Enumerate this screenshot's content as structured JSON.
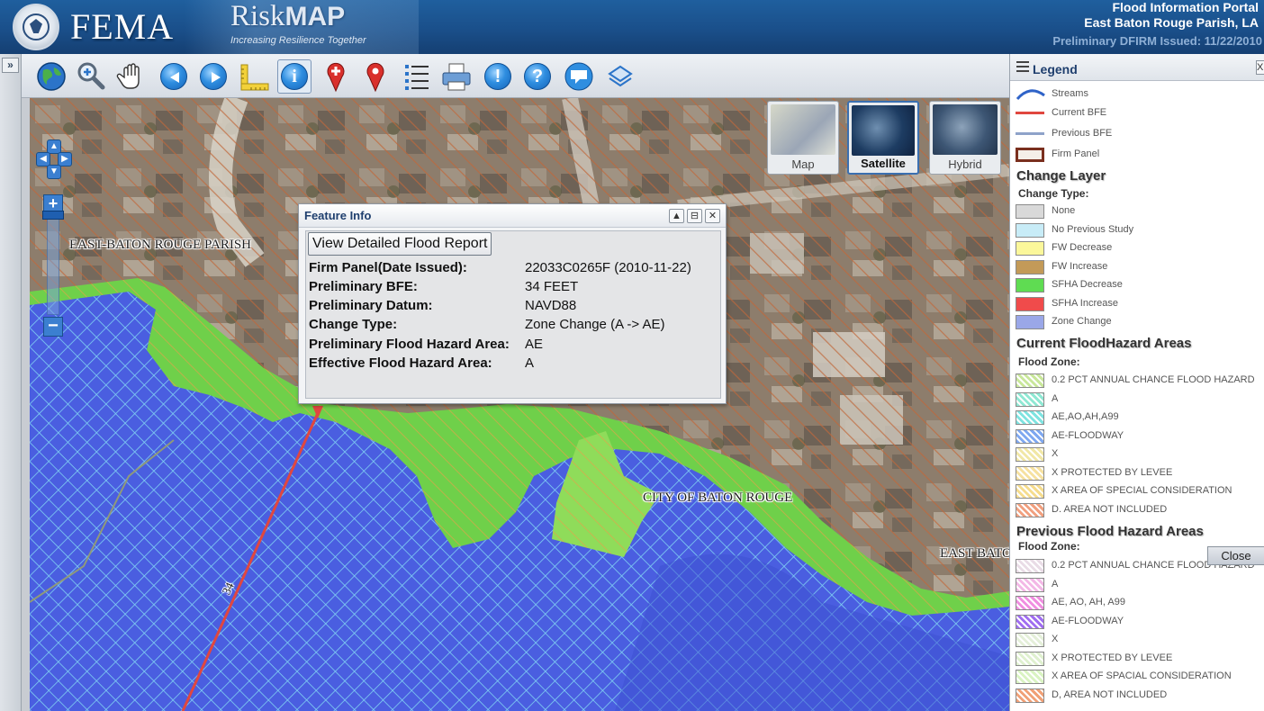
{
  "header": {
    "agency_logo": "FEMA",
    "product_logo_main": "Risk",
    "product_logo_accent": "MAP",
    "tagline": "Increasing Resilience Together",
    "portal_title": "Flood Information Portal",
    "parish": "East Baton Rouge Parish, LA",
    "issued": "Preliminary DFIRM Issued: 11/22/2010"
  },
  "side_toggle": "»",
  "toolbar": {
    "tools": [
      {
        "name": "full-extent-globe-tool",
        "icon": "globe-icon"
      },
      {
        "name": "zoom-tool",
        "icon": "magnifier-icon"
      },
      {
        "name": "pan-tool",
        "icon": "hand-icon"
      },
      {
        "name": "previous-extent-tool",
        "icon": "arrow-left-icon"
      },
      {
        "name": "next-extent-tool",
        "icon": "arrow-right-icon"
      },
      {
        "name": "measure-tool",
        "icon": "ruler-icon"
      },
      {
        "name": "identify-tool",
        "icon": "info-icon",
        "glyph": "i"
      },
      {
        "name": "add-marker-tool",
        "icon": "pushpin-plus-icon"
      },
      {
        "name": "locate-address-tool",
        "icon": "pushpin-icon"
      },
      {
        "name": "legend-tool",
        "icon": "list-icon"
      },
      {
        "name": "print-tool",
        "icon": "printer-icon"
      },
      {
        "name": "alert-tool",
        "icon": "exclamation-icon",
        "glyph": "!"
      },
      {
        "name": "help-tool",
        "icon": "question-icon",
        "glyph": "?"
      },
      {
        "name": "comment-tool",
        "icon": "speech-bubble-icon"
      },
      {
        "name": "layers-tool",
        "icon": "layers-icon"
      }
    ]
  },
  "map": {
    "basemaps": [
      {
        "label": "Map",
        "selected": false
      },
      {
        "label": "Satellite",
        "selected": true
      },
      {
        "label": "Hybrid",
        "selected": false
      }
    ],
    "labels": {
      "parish_label": "EAST-BATON ROUGE PARISH",
      "city_label": "CITY OF BATON ROUGE",
      "east_label": "EAST BATO",
      "bfe_label": "34"
    },
    "nav": {
      "zoom_in": "+",
      "zoom_out": "−"
    }
  },
  "feature_info": {
    "title": "Feature Info",
    "report_button": "View Detailed Flood Report",
    "window_buttons": {
      "collapse": "▲",
      "maximize": "⊟",
      "close": "✕"
    },
    "rows": [
      {
        "key": "Firm Panel(Date Issued):",
        "value": "22033C0265F (2010-11-22)"
      },
      {
        "key": "Preliminary BFE:",
        "value": "34 FEET"
      },
      {
        "key": "Preliminary Datum:",
        "value": "NAVD88"
      },
      {
        "key": "Change Type:",
        "value": "Zone Change (A -> AE)"
      },
      {
        "key": "Preliminary Flood Hazard Area:",
        "value": "AE"
      },
      {
        "key": "Effective Flood Hazard Area:",
        "value": "A"
      }
    ]
  },
  "legend": {
    "title": "Legend",
    "close_x": "X",
    "close_button": "Close",
    "lines": [
      {
        "label": "Streams",
        "color": "#2f63c8"
      },
      {
        "label": "Current BFE",
        "color": "#e0473f"
      },
      {
        "label": "Previous BFE",
        "color": "#8ea2c9"
      },
      {
        "label": "Firm Panel",
        "color": "#7a2f1e"
      }
    ],
    "change_layer_heading": "Change Layer",
    "change_type_heading": "Change Type:",
    "change_types": [
      {
        "label": "None",
        "color": "#d9d9d9"
      },
      {
        "label": "No Previous Study",
        "color": "#c8ecf7"
      },
      {
        "label": "FW Decrease",
        "color": "#fbf79a"
      },
      {
        "label": "FW Increase",
        "color": "#c39a58"
      },
      {
        "label": "SFHA Decrease",
        "color": "#5fdc52"
      },
      {
        "label": "SFHA Increase",
        "color": "#f04b4b"
      },
      {
        "label": "Zone Change",
        "color": "#9aa7e8"
      }
    ],
    "current_heading": "Current FloodHazard Areas",
    "current_sub": "Flood Zone:",
    "current_zones": [
      {
        "label": "0.2 PCT ANNUAL CHANCE FLOOD HAZARD",
        "color": "#c9e79b"
      },
      {
        "label": "A",
        "color": "#8fe8d3"
      },
      {
        "label": "AE,AO,AH,A99",
        "color": "#7ee3e0"
      },
      {
        "label": "AE-FLOODWAY",
        "color": "#7fa8f0"
      },
      {
        "label": "X",
        "color": "#f1e7a6"
      },
      {
        "label": "X PROTECTED BY LEVEE",
        "color": "#f6e1a0"
      },
      {
        "label": "X AREA OF SPECIAL CONSIDERATION",
        "color": "#f5dc8e"
      },
      {
        "label": "D. AREA NOT INCLUDED",
        "color": "#f1a07f"
      }
    ],
    "previous_heading": "Previous Flood Hazard Areas",
    "previous_sub": "Flood Zone:",
    "previous_zones": [
      {
        "label": "0.2 PCT ANNUAL CHANCE FLOOD HAZARD",
        "color": "#e9dce6"
      },
      {
        "label": "A",
        "color": "#f3b8e6"
      },
      {
        "label": "AE, AO, AH, A99",
        "color": "#f08ee0"
      },
      {
        "label": "AE-FLOODWAY",
        "color": "#a06ef0"
      },
      {
        "label": "X",
        "color": "#e4efd9"
      },
      {
        "label": "X PROTECTED BY LEVEE",
        "color": "#dff0cf"
      },
      {
        "label": "X AREA OF SPACIAL CONSIDERATION",
        "color": "#d9f3c2"
      },
      {
        "label": "D, AREA NOT INCLUDED",
        "color": "#f0a076"
      }
    ]
  }
}
